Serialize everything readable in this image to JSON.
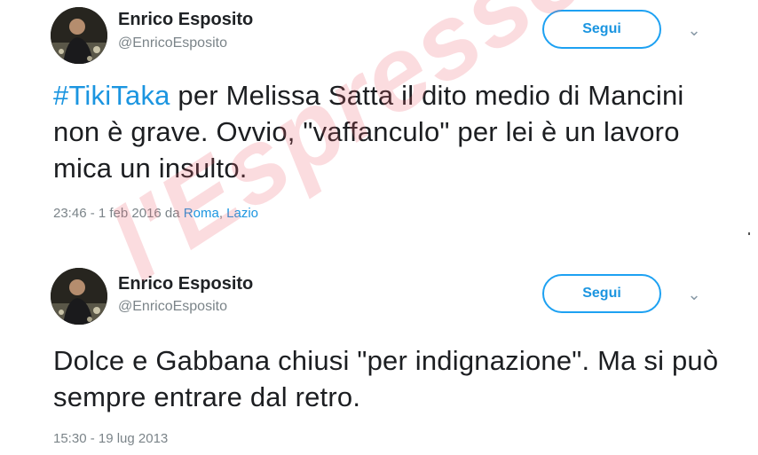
{
  "tweets": [
    {
      "name": "Enrico Esposito",
      "handle": "@EnricoEsposito",
      "follow_label": "Segui",
      "caret": "⌄",
      "hashtag": "#TikiTaka",
      "text": " per Melissa Satta il dito medio di Mancini non è grave. Ovvio, \"vaffanculo\" per lei è un lavoro mica un insulto.",
      "time": "23:46 - 1 feb 2016 da ",
      "place_city": "Roma",
      "place_sep": ", ",
      "place_region": "Lazio"
    },
    {
      "name": "Enrico Esposito",
      "handle": "@EnricoEsposito",
      "follow_label": "Segui",
      "caret": "⌄",
      "text": "Dolce e Gabbana chiusi \"per indignazione\". Ma si può sempre entrare dal retro.",
      "time": "15:30 - 19 lug 2013"
    }
  ],
  "watermark": "l'Espresso",
  "colors": {
    "link": "#1b95e0",
    "button_border": "#1da1f2",
    "watermark": "#eb5f6e"
  }
}
